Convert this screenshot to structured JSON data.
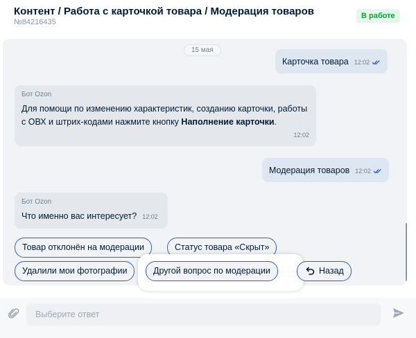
{
  "header": {
    "title": "Контент / Работа с карточкой товара / Модерация товаров",
    "ticket": "№84216435",
    "status": "В работе"
  },
  "chat": {
    "date": "15 мая",
    "messages": [
      {
        "type": "out",
        "text": "Карточка товара",
        "time": "12:02",
        "read": true
      },
      {
        "type": "in",
        "sender": "Бот Ozon",
        "text_before": "Для помощи по изменению характеристик, созданию карточки, работы с ОВХ и штрих-кодами нажмите кнопку ",
        "text_bold": "Наполнение карточки",
        "text_after": ".",
        "time": "12:02"
      },
      {
        "type": "out",
        "text": "Модерация товаров",
        "time": "12:02",
        "read": true
      },
      {
        "type": "in",
        "sender": "Бот Ozon",
        "text": "Что именно вас интересует?",
        "time": "12:02"
      }
    ]
  },
  "quick_replies": [
    "Товар отклонён на модерации",
    "Статус товара «Скрыт»",
    "Удалили мои фотографии",
    "Другой вопрос по модерации",
    "Назад"
  ],
  "composer": {
    "placeholder": "Выберите ответ",
    "value": ""
  },
  "icons": {
    "attach": "paperclip-icon",
    "send": "send-icon",
    "read": "double-check-icon",
    "back": "undo-arrow-icon"
  },
  "colors": {
    "accent": "#2a62c8",
    "status_green": "#0aa33a",
    "status_bg": "#e5f6ea",
    "chat_bg": "#f1f3f6",
    "outgoing_bubble": "#dee6f2",
    "incoming_bubble": "#e4e7ec"
  }
}
